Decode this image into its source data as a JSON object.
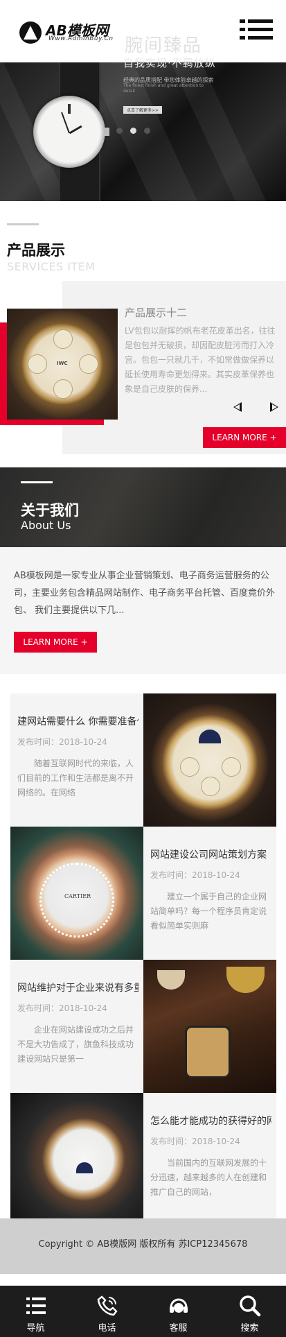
{
  "header": {
    "logo_text": "AB模板网",
    "logo_sub": "Www.AdminBuy.Cn",
    "menu_icon": "hamburger-icon"
  },
  "banner": {
    "title": "腕间臻品",
    "subtitle": "自我实现·不羁放纵",
    "desc_line1": "经典的品质搭配 带您体验卓越的探索",
    "desc_line2": "The finest finish and great attention to detail",
    "more": "点击了解更多>>",
    "slides": 3,
    "active_slide": 1
  },
  "products": {
    "title": "产品展示",
    "subtitle": "SERVICES ITEM",
    "item_name": "产品展示十二",
    "item_desc": "LV包包以耐挥的帆布老花皮革出名，往往是包包并无破损，却因配皮脏污而打入冷宫。包包一只就几千，不如常做做保养以延长使用寿命更划得来。其实皮革保养也象是自己皮肤的保养...",
    "more": "LEARN MORE +",
    "prev_icon": "prev-arrow-icon",
    "next_icon": "next-arrow-icon"
  },
  "about": {
    "title": "关于我们",
    "subtitle": "About Us",
    "text": "AB模板网是一家专业从事企业营销策划、电子商务运营服务的公司，主要业务包含精品网站制作、电子商务平台托管、百度竟价外包、 我们主要提供以下几...",
    "more": "LEARN MORE +"
  },
  "news": [
    {
      "title": "建网站需要什么 你需要准备什么",
      "date": "发布时间：2018-10-24",
      "excerpt": "随着互联网时代的来临，人们目前的工作和生活都是离不开网络的。在网络"
    },
    {
      "title": "网站建设公司网站策划方案",
      "date": "发布时间：2018-10-24",
      "excerpt": "建立一个属于自己的企业网站简单吗？每一个程序员肯定说看似简单实则麻"
    },
    {
      "title": "网站维护对于企业来说有多重要",
      "date": "发布时间：2018-10-24",
      "excerpt": "企业在网站建设成功之后并不是大功告成了，旗鱼科技成功建设网站只是第一"
    },
    {
      "title": "怎么能才能成功的获得好的网站",
      "date": "发布时间：2018-10-24",
      "excerpt": "当前国内的互联网发展的十分迅速，越来越多的人在创建和推广自己的网站，"
    }
  ],
  "footer": {
    "copyright": "Copyright © AB模版网 版权所有    苏ICP12345678"
  },
  "bottom_nav": [
    {
      "label": "导航",
      "icon": "menu-list-icon"
    },
    {
      "label": "电话",
      "icon": "phone-icon"
    },
    {
      "label": "客服",
      "icon": "customer-service-icon"
    },
    {
      "label": "搜索",
      "icon": "search-icon"
    }
  ],
  "colors": {
    "accent": "#e4002b",
    "dark": "#1d1d1d"
  }
}
